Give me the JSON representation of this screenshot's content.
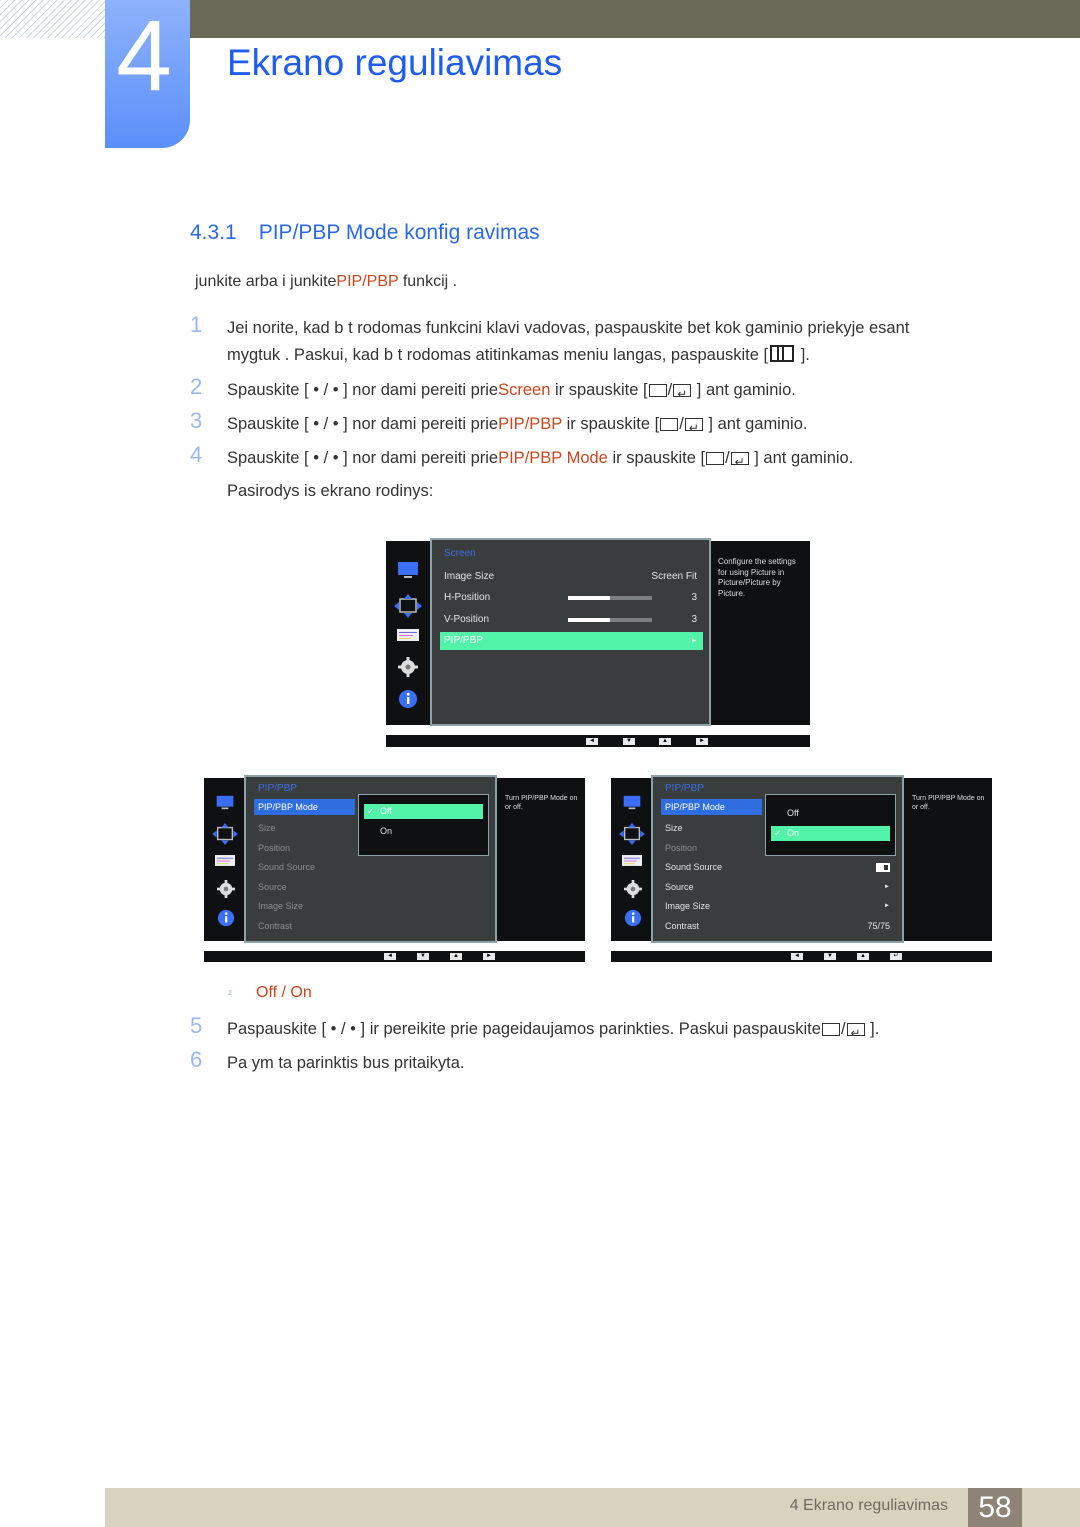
{
  "chapter": {
    "number": "4",
    "title": "Ekrano reguliavimas"
  },
  "section": {
    "number": "4.3.1",
    "title": "PIP/PBP Mode konfig ravimas"
  },
  "intro": {
    "before": "junkite arba i junkite",
    "highlight": "PIP/PBP",
    "after": " funkcij ."
  },
  "steps": [
    {
      "n": "1",
      "line1": "Jei norite, kad b t  rodomas funkcini  klavi    vadovas, paspauskite bet kok  gaminio priekyje esant",
      "line2_before": "mygtuk . Paskui, kad b t  rodomas atitinkamas meniu langas, paspauskite [",
      "line2_after": " ]."
    },
    {
      "n": "2",
      "before": "Spauskite [ • / •  ] nor dami pereiti prie",
      "highlight": "Screen",
      "after_a": " ir spauskite [",
      "after_b": " ] ant gaminio."
    },
    {
      "n": "3",
      "before": "Spauskite [ • / •  ] nor dami pereiti prie",
      "highlight": "PIP/PBP",
      "after_a": " ir spauskite [",
      "after_b": " ] ant gaminio."
    },
    {
      "n": "4",
      "before": "Spauskite [ • / •  ] nor dami pereiti prie",
      "highlight": "PIP/PBP Mode",
      "after_a": "  ir spauskite [",
      "after_b": " ] ant gaminio.",
      "line2": "Pasirodys  is ekrano rodinys:"
    },
    {
      "n": "5",
      "before": "Paspauskite [ • / •  ] ir pereikite prie pageidaujamos parinkties. Paskui paspauskite",
      "after_b": "    ]."
    },
    {
      "n": "6",
      "text": "Pa ym ta parinktis bus pritaikyta."
    }
  ],
  "options_bullet": {
    "dot": "z",
    "off": "Off",
    "sep": " / ",
    "on": "On"
  },
  "osd_screen": {
    "header": "Screen",
    "rows": [
      {
        "label": "Image Size",
        "value": "Screen Fit"
      },
      {
        "label": "H-Position",
        "value": "3",
        "level": 0.5
      },
      {
        "label": "V-Position",
        "value": "3",
        "level": 0.5
      },
      {
        "label": "PIP/PBP",
        "value": "►"
      }
    ],
    "help": "Configure the settings for using Picture in Picture/Picture by Picture.",
    "keys": [
      "◄",
      "▼",
      "▲",
      "►"
    ]
  },
  "osd_off": {
    "header": "PIP/PBP",
    "rows": [
      "PIP/PBP Mode",
      "Size",
      "Position",
      "Sound Source",
      "Source",
      "Image Size",
      "Contrast"
    ],
    "popup": {
      "check": "✓",
      "options": [
        "Off",
        "On"
      ],
      "selected": "Off"
    },
    "help": "Turn PIP/PBP Mode on or off.",
    "keys": [
      "◄",
      "▼",
      "▲",
      "►"
    ]
  },
  "osd_on": {
    "header": "PIP/PBP",
    "rows": [
      {
        "label": "PIP/PBP Mode",
        "value": ""
      },
      {
        "label": "Size",
        "value": ""
      },
      {
        "label": "Position",
        "value": ""
      },
      {
        "label": "Sound Source",
        "value": ""
      },
      {
        "label": "Source",
        "value": "►"
      },
      {
        "label": "Image Size",
        "value": "►"
      },
      {
        "label": "Contrast",
        "value": "75/75"
      }
    ],
    "popup": {
      "check": "✓",
      "options": [
        "Off",
        "On"
      ],
      "selected": "On"
    },
    "help": "Turn PIP/PBP Mode on or off.",
    "keys": [
      "◄",
      "▼",
      "▲",
      "↵"
    ]
  },
  "footer": {
    "text": "4 Ekrano reguliavimas",
    "page": "58"
  },
  "colors": {
    "accent_blue": "#1f5cf2",
    "highlight": "#c8461e",
    "osd_green": "#50f3a8",
    "osd_blue": "#2f6ee0"
  }
}
